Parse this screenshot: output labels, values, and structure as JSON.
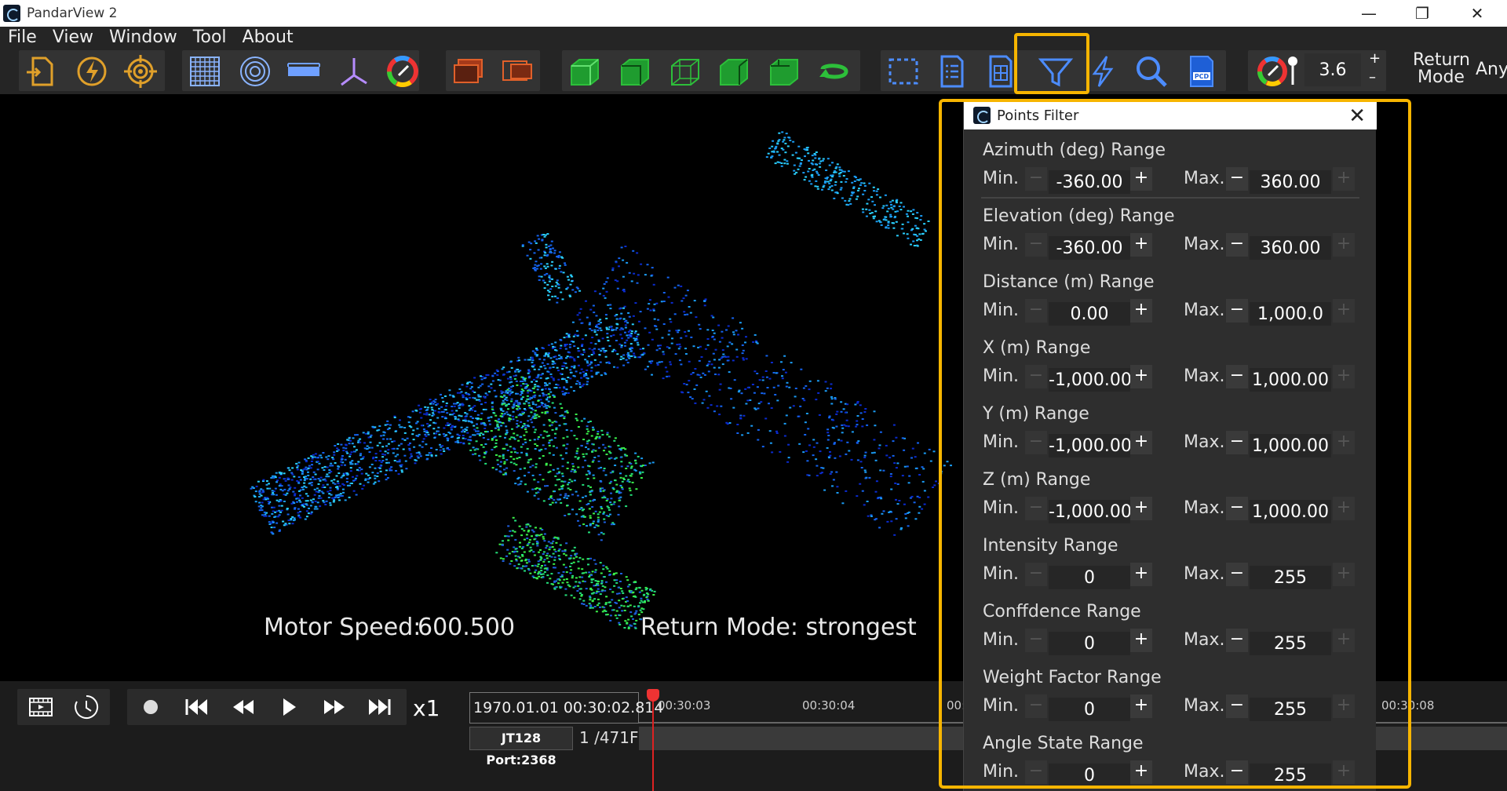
{
  "window": {
    "title": "PandarView 2"
  },
  "menu": [
    "File",
    "View",
    "Window",
    "Tool",
    "About"
  ],
  "toolbar": {
    "point_size": "3.6",
    "return_mode_label": "Return\nMode",
    "return_mode_value": "Any"
  },
  "viewport": {
    "motor_speed_label": "Motor Speed:",
    "motor_speed_value": "600.500",
    "return_mode_text": "Return Mode: strongest"
  },
  "points_filter": {
    "title": "Points Filter",
    "min_label": "Min.",
    "max_label": "Max.",
    "ranges": [
      {
        "label": "Azimuth (deg) Range",
        "min": "-360.00",
        "max": "360.00"
      },
      {
        "label": "Elevation (deg) Range",
        "min": "-360.00",
        "max": "360.00"
      },
      {
        "label": "Distance (m) Range",
        "min": "0.00",
        "max": "1,000.0"
      },
      {
        "label": "X (m) Range",
        "min": "-1,000.00",
        "max": "1,000.00"
      },
      {
        "label": "Y (m) Range",
        "min": "-1,000.00",
        "max": "1,000.00"
      },
      {
        "label": "Z (m) Range",
        "min": "-1,000.00",
        "max": "1,000.00"
      },
      {
        "label": "Intensity Range",
        "min": "0",
        "max": "255"
      },
      {
        "label": "Conffdence Range",
        "min": "0",
        "max": "255"
      },
      {
        "label": "Weight Factor Range",
        "min": "0",
        "max": "255"
      },
      {
        "label": "Angle State Range",
        "min": "0",
        "max": "255"
      }
    ]
  },
  "playback": {
    "speed": "x1",
    "timestamp": "1970.01.01 00:30:02.814",
    "port_tag": "JT128 Port:2368",
    "frame_counter": "1 /471F",
    "ticks": [
      "00:30:03",
      "00:30:04",
      "00:",
      "00:30:08"
    ]
  },
  "colors": {
    "highlight": "#f7b500",
    "accent_green": "#2dbf3a",
    "accent_orange": "#e0a02a"
  }
}
